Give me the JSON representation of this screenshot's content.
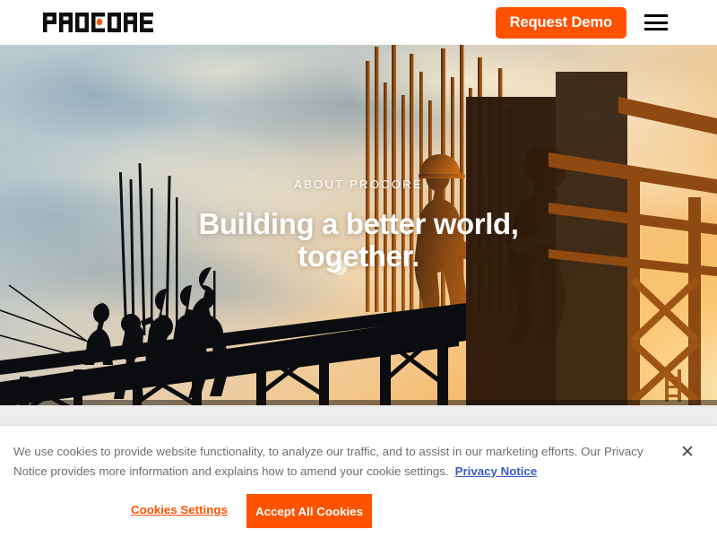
{
  "header": {
    "logo_text": "PROCORE",
    "logo_name": "procore-logo",
    "request_demo_label": "Request Demo",
    "menu_icon": "hamburger-menu-icon",
    "accent_color": "#ff5200"
  },
  "hero": {
    "eyebrow": "ABOUT PROCORE",
    "headline": "Building a better world, together.",
    "image_description": "Construction workers in hard hats silhouetted on scaffolding against a sunset sky",
    "text_color": "#ffffff"
  },
  "cookie_banner": {
    "message": "We use cookies to provide website functionality, to analyze our traffic, and to assist in our marketing efforts. Our Privacy Notice provides more information and explains how to amend your cookie settings.",
    "privacy_link_label": "Privacy Notice",
    "privacy_link_color": "#3b5bc4",
    "settings_label": "Cookies Settings",
    "accept_label": "Accept All Cookies",
    "close_icon": "close-x-icon",
    "close_glyph": "✕",
    "accent_color": "#ff5200"
  }
}
